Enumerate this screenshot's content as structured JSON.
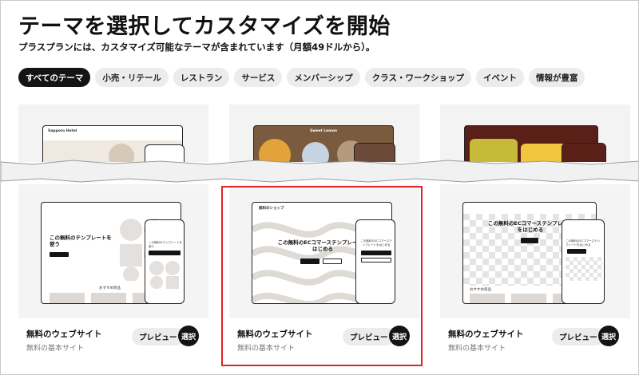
{
  "page": {
    "title": "テーマを選択してカスタマイズを開始",
    "subtitle": "プラスプランには、カスタマイズ可能なテーマが含まれています（月額49ドルから）。"
  },
  "filters": [
    {
      "label": "すべてのテーマ",
      "active": true
    },
    {
      "label": "小売・リテール",
      "active": false
    },
    {
      "label": "レストラン",
      "active": false
    },
    {
      "label": "サービス",
      "active": false
    },
    {
      "label": "メンバーシップ",
      "active": false
    },
    {
      "label": "クラス・ワークショップ",
      "active": false
    },
    {
      "label": "イベント",
      "active": false
    },
    {
      "label": "情報が豊富",
      "active": false
    }
  ],
  "top_cards": [
    {
      "brand": "Sapporo Hotel"
    },
    {
      "brand": "Sweet Lemon"
    },
    {
      "brand": ""
    }
  ],
  "cards": [
    {
      "name": "無料のウェブサイト",
      "sub": "無料の基本サイト",
      "preview": "プレビュー",
      "select": "選択",
      "mock_heading": "この無料のテンプレートを使う",
      "phone_heading": "この無料のテンプレートを使う",
      "section_label": "おすすめ商品"
    },
    {
      "name": "無料のウェブサイト",
      "sub": "無料の基本サイト",
      "preview": "プレビュー",
      "select": "選択",
      "mock_heading": "この無料のECコマーステンプレートをはじめる",
      "phone_heading": "この無料のECコマーステンプレートをはじめる",
      "mock_brand": "無料のショップ"
    },
    {
      "name": "無料のウェブサイト",
      "sub": "無料の基本サイト",
      "preview": "プレビュー",
      "select": "選択",
      "mock_heading": "この無料のECコマーステンプレートをはじめる",
      "phone_heading": "この無料のECコマーステンプレートをはじめる",
      "section_label": "おすすめ商品"
    }
  ],
  "colors": {
    "highlight": "#e02424",
    "dark_button": "#141414",
    "chip_bg": "#ececec"
  }
}
